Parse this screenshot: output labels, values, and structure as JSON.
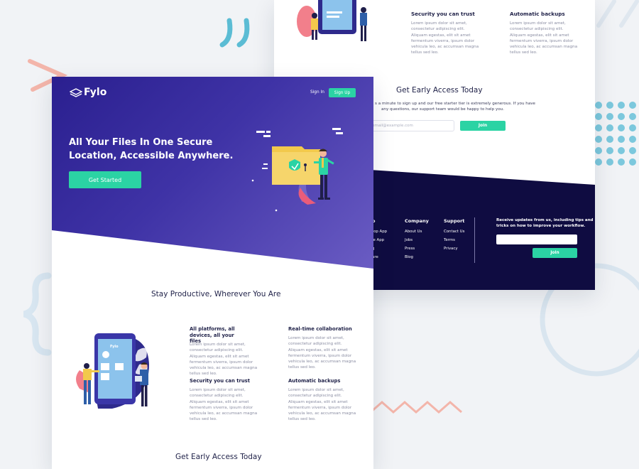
{
  "back_page": {
    "features": [
      {
        "title": "Security you can trust",
        "body": "Lorem ipsum dolor sit amet, consectetur adipiscing elit. Aliquam egestas, elit sit amet fermentum viverra, ipsum dolor vehicula leo, ac accumsan magna tellus sed leo."
      },
      {
        "title": "Automatic backups",
        "body": "Lorem ipsum dolor sit amet, consectetur adipiscing elit. Aliquam egestas, elit sit amet fermentum viverra, ipsum dolor vehicula leo, ac accumsan magna tellus sed leo."
      }
    ],
    "early_access": {
      "title": "Get Early Access Today",
      "line1": "s a minute to sign up and our free starter tier is extremely generous. If you have",
      "line2": "any questions, our support team would be happy to help you.",
      "email_placeholder": "email@example.com",
      "join_label": "Join"
    },
    "footer": {
      "col1_title": "o",
      "col1_links": [
        "top App",
        "le App",
        "g",
        "ure"
      ],
      "company_title": "Company",
      "company_links": [
        "About Us",
        "Jobs",
        "Press",
        "Blog"
      ],
      "support_title": "Support",
      "support_links": [
        "Contact Us",
        "Terms",
        "Privacy"
      ],
      "newsletter_line1": "Receive updates from us, including tips and",
      "newsletter_line2": "tricks on how to improve your workflow.",
      "join_label": "Join"
    }
  },
  "front_page": {
    "logo": "Fylo",
    "nav": {
      "signin": "Sign In",
      "signup": "Sign Up"
    },
    "hero": {
      "line1": "All Your Files In One Secure",
      "line2": "Location, Accessible Anywhere.",
      "cta": "Get Started"
    },
    "section_title": "Stay Productive, Wherever You Are",
    "phone_logo": "Fylo",
    "features": [
      {
        "title": "All platforms, all devices, all your files",
        "body": "Lorem ipsum dolor sit amet, consectetur adipiscing elit. Aliquam egestas, elit sit amet fermentum viverra, ipsum dolor vehicula leo, ac accumsan magna tellus sed leo."
      },
      {
        "title": "Real-time collaboration",
        "body": "Lorem ipsum dolor sit amet, consectetur adipiscing elit. Aliquam egestas, elit sit amet fermentum viverra, ipsum dolor vehicula leo, ac accumsan magna tellus sed leo."
      },
      {
        "title": "Security you can trust",
        "body": "Lorem ipsum dolor sit amet, consectetur adipiscing elit. Aliquam egestas, elit sit amet fermentum viverra, ipsum dolor vehicula leo, ac accumsan magna tellus sed leo."
      },
      {
        "title": "Automatic backups",
        "body": "Lorem ipsum dolor sit amet, consectetur adipiscing elit. Aliquam egestas, elit sit amet fermentum viverra, ipsum dolor vehicula leo, ac accumsan magna tellus sed leo."
      }
    ],
    "early_access_title": "Get Early Access Today"
  },
  "colors": {
    "accent": "#2bd3a4",
    "hero_start": "#2a1f8f",
    "hero_end": "#6a5cc3",
    "footer_bg": "#0f0c41",
    "background": "#f1f3f6"
  }
}
